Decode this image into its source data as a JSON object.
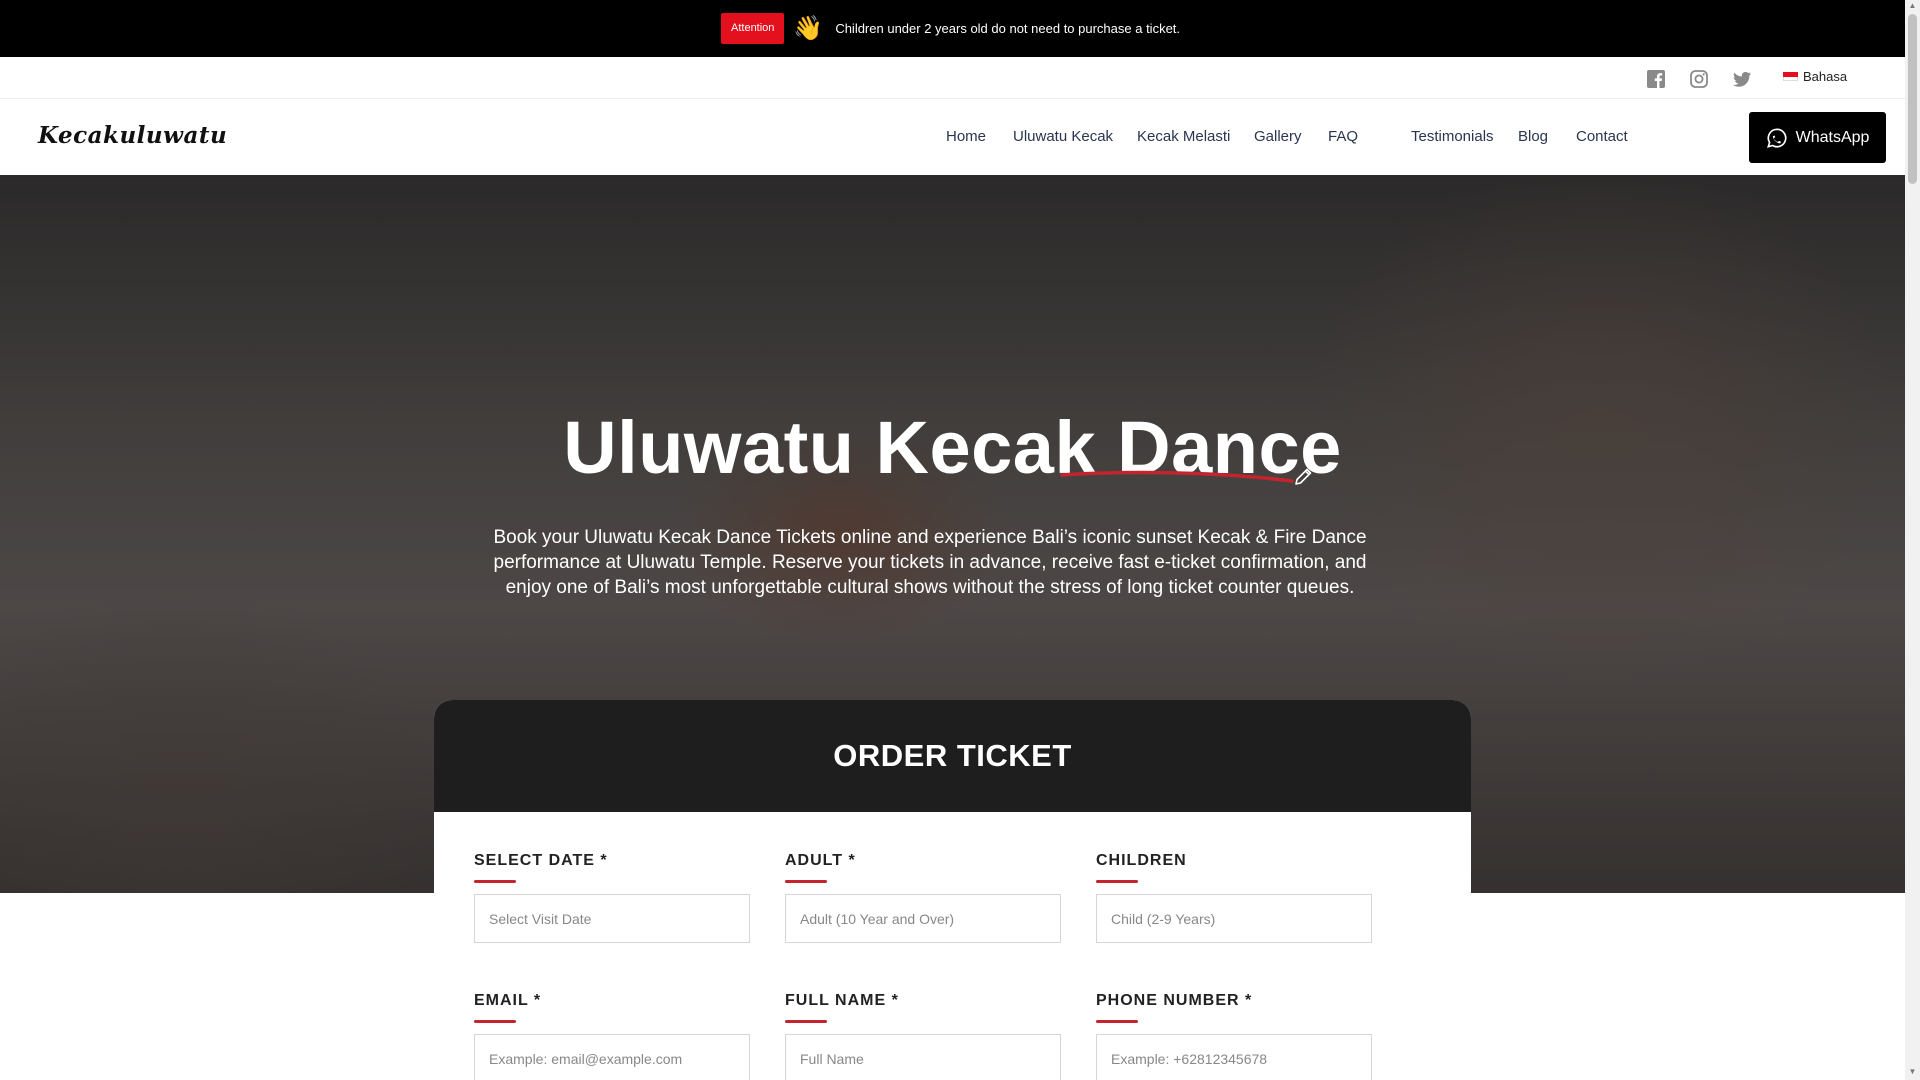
{
  "announcement": {
    "badge": "Attention",
    "emoji": "👋",
    "text": "Children under 2 years old do not need to purchase a ticket."
  },
  "topbar": {
    "social": [
      "facebook-icon",
      "instagram-icon",
      "twitter-icon"
    ],
    "language": "Bahasa"
  },
  "nav": {
    "logo": "Kecakuluwatu",
    "links": [
      "Home",
      "Uluwatu Kecak",
      "Kecak Melasti",
      "Gallery",
      "FAQ",
      "Testimonials",
      "Blog",
      "Contact"
    ],
    "whatsapp": "WhatsApp"
  },
  "hero": {
    "title": "Uluwatu Kecak Dance",
    "description": "Book your Uluwatu Kecak Dance Tickets online and experience Bali’s iconic sunset Kecak & Fire Dance performance at Uluwatu Temple. Reserve your tickets in advance, receive fast e-ticket confirmation, and enjoy one of Bali’s most unforgettable cultural shows without the stress of long ticket counter queues."
  },
  "order": {
    "title": "ORDER TICKET",
    "fields": [
      {
        "label": "SELECT DATE *",
        "placeholder": "Select Visit Date"
      },
      {
        "label": "ADULT *",
        "placeholder": "Adult (10 Year and Over)"
      },
      {
        "label": "CHILDREN",
        "placeholder": "Child (2-9 Years)"
      },
      {
        "label": "EMAIL *",
        "placeholder": "Example: email@example.com"
      },
      {
        "label": "FULL NAME *",
        "placeholder": "Full Name"
      },
      {
        "label": "PHONE NUMBER *",
        "placeholder": "Example: +62812345678"
      }
    ]
  },
  "colors": {
    "accent": "#e5101e",
    "underline": "#c3242e",
    "dark": "#1e1e1e"
  }
}
